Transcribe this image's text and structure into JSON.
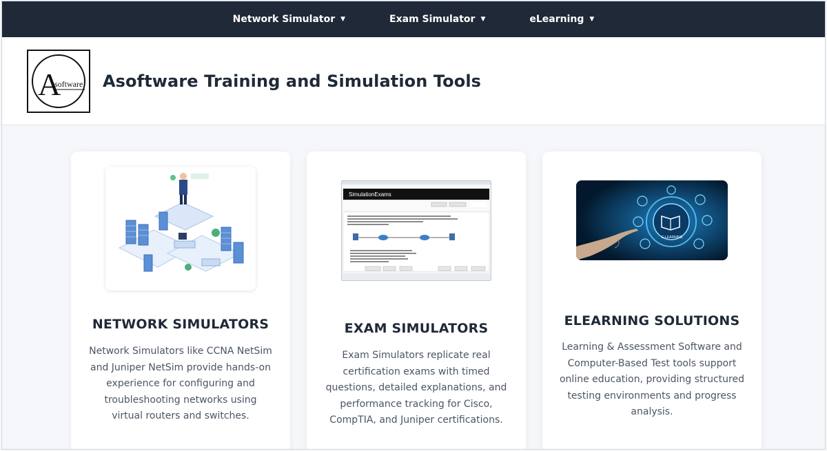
{
  "nav": {
    "items": [
      {
        "label": "Network Simulator"
      },
      {
        "label": "Exam Simulator"
      },
      {
        "label": "eLearning"
      }
    ]
  },
  "header": {
    "logo_text": "Asoftware",
    "logo_initial": "A",
    "logo_word": "software",
    "title": "Asoftware Training and Simulation Tools"
  },
  "cards": [
    {
      "title": "NETWORK SIMULATORS",
      "description": "Network Simulators like CCNA NetSim and Juniper NetSim provide hands-on experience for configuring and troubleshooting networks using virtual routers and switches.",
      "image": "network-isometric-illustration"
    },
    {
      "title": "EXAM SIMULATORS",
      "description": "Exam Simulators replicate real certification exams with timed questions, detailed explanations, and performance tracking for Cisco, CompTIA, and Juniper certifications.",
      "image": "exam-software-screenshot",
      "screenshot_app_name": "SimulationExams"
    },
    {
      "title": "ELEARNING SOLUTIONS",
      "description": "Learning & Assessment Software and Computer-Based Test tools support online education, providing structured testing environments and progress analysis.",
      "image": "elearning-hand-touch",
      "image_label": "E-LEARNING"
    }
  ],
  "colors": {
    "navbar_bg": "#1f2937",
    "page_bg": "#f5f7fa",
    "card_bg": "#ffffff",
    "heading": "#1f2937",
    "body_text": "#4b5563"
  }
}
